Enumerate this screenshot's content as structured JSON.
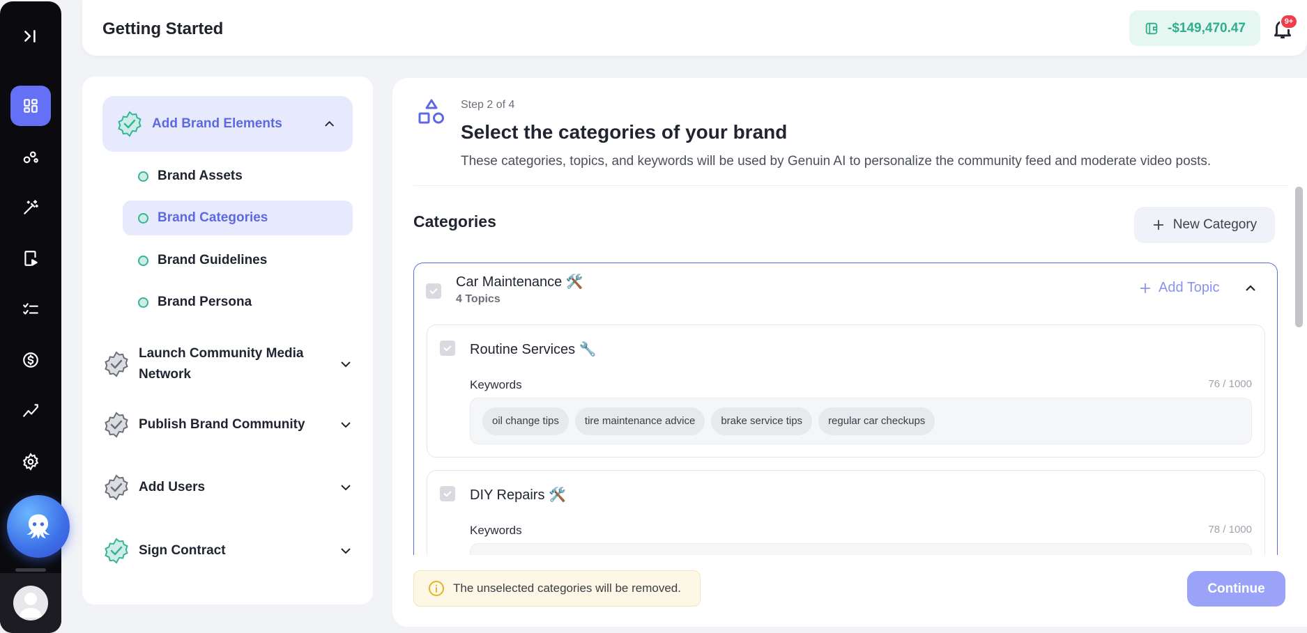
{
  "header": {
    "title": "Getting Started",
    "wallet_balance": "-$149,470.47",
    "notification_badge": "9+"
  },
  "rail": {
    "icons": [
      "expand-icon",
      "dashboard-icon",
      "nodes-icon",
      "magic-wand-icon",
      "video-post-icon",
      "checklist-icon",
      "dollar-icon",
      "analytics-icon",
      "settings-icon"
    ]
  },
  "steps": {
    "items": [
      {
        "label": "Add Brand Elements",
        "state": "completed",
        "expanded": true
      },
      {
        "label": "Launch Community Media Network",
        "state": "pending"
      },
      {
        "label": "Publish Brand Community",
        "state": "pending"
      },
      {
        "label": "Add Users",
        "state": "pending"
      },
      {
        "label": "Sign Contract",
        "state": "completed"
      }
    ],
    "subitems": [
      {
        "label": "Brand Assets"
      },
      {
        "label": "Brand Categories",
        "active": true
      },
      {
        "label": "Brand Guidelines"
      },
      {
        "label": "Brand Persona"
      }
    ]
  },
  "main": {
    "step": "Step 2 of 4",
    "title": "Select the categories of your brand",
    "description": "These categories, topics, and keywords will be used by Genuin AI to personalize the community feed and moderate video posts.",
    "categories_title": "Categories",
    "new_category": "New Category",
    "category": {
      "name": "Car Maintenance 🛠️",
      "topic_count": "4 Topics",
      "add_topic": "Add Topic",
      "topics": [
        {
          "name": "Routine Services 🔧",
          "keywords_label": "Keywords",
          "keywords_count": "76 / 1000",
          "keywords": [
            "oil change tips",
            "tire maintenance advice",
            "brake service tips",
            "regular car checkups"
          ]
        },
        {
          "name": "DIY Repairs 🛠️",
          "keywords_label": "Keywords",
          "keywords_count": "78 / 1000",
          "keywords": []
        }
      ]
    },
    "notice": "The unselected categories will be removed.",
    "continue": "Continue"
  },
  "colors": {
    "accent": "#5c69e0",
    "rail": "#0b0b0f",
    "wallet": "#2fae8f",
    "badge": "#ef3d4a",
    "continue": "#9aa3f7"
  }
}
